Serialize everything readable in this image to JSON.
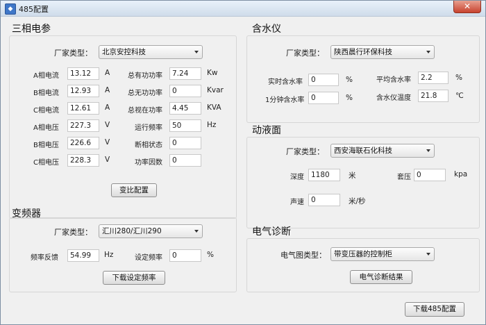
{
  "window": {
    "title": "485配置",
    "icon_name": "app-icon",
    "close_icon": "close-icon",
    "close_glyph": "✕"
  },
  "three_phase": {
    "title": "三相电参",
    "vendor_label": "厂家类型：",
    "vendor_value": "北京安控科技",
    "left_rows": [
      {
        "label": "A相电流",
        "value": "13.12",
        "unit": "A"
      },
      {
        "label": "B相电流",
        "value": "12.93",
        "unit": "A"
      },
      {
        "label": "C相电流",
        "value": "12.61",
        "unit": "A"
      },
      {
        "label": "A相电压",
        "value": "227.3",
        "unit": "V"
      },
      {
        "label": "B相电压",
        "value": "226.6",
        "unit": "V"
      },
      {
        "label": "C相电压",
        "value": "228.3",
        "unit": "V"
      }
    ],
    "right_rows": [
      {
        "label": "总有功功率",
        "value": "7.24",
        "unit": "Kw"
      },
      {
        "label": "总无功功率",
        "value": "0",
        "unit": "Kvar"
      },
      {
        "label": "总视在功率",
        "value": "4.45",
        "unit": "KVA"
      },
      {
        "label": "运行频率",
        "value": "50",
        "unit": "Hz"
      },
      {
        "label": "断相状态",
        "value": "0",
        "unit": ""
      },
      {
        "label": "功率因数",
        "value": "0",
        "unit": ""
      }
    ],
    "button": "变比配置"
  },
  "inverter": {
    "title": "变频器",
    "vendor_label": "厂家类型：",
    "vendor_value": "汇川280/汇川290",
    "feedback_label": "频率反馈",
    "feedback_value": "54.99",
    "feedback_unit": "Hz",
    "set_label": "设定频率",
    "set_value": "0",
    "set_unit": "%",
    "button": "下载设定频率"
  },
  "water_meter": {
    "title": "含水仪",
    "vendor_label": "厂家类型：",
    "vendor_value": "陕西晨行环保科技",
    "realtime_label": "实时含水率",
    "realtime_value": "0",
    "realtime_unit": "%",
    "minute_label": "1分钟含水率",
    "minute_value": "0",
    "minute_unit": "%",
    "avg_label": "平均含水率",
    "avg_value": "2.2",
    "avg_unit": "%",
    "temp_label": "含水仪温度",
    "temp_value": "21.8",
    "temp_unit": "℃"
  },
  "fluid_level": {
    "title": "动液面",
    "vendor_label": "厂家类型：",
    "vendor_value": "西安海联石化科技",
    "depth_label": "深度",
    "depth_value": "1180",
    "depth_unit": "米",
    "casing_label": "套压",
    "casing_value": "0",
    "casing_unit": "kpa",
    "sound_label": "声速",
    "sound_value": "0",
    "sound_unit": "米/秒"
  },
  "electric_diag": {
    "title": "电气诊断",
    "type_label": "电气图类型：",
    "type_value": "带变压器的控制柜",
    "button": "电气诊断结果"
  },
  "footer": {
    "download_button": "下载485配置"
  }
}
